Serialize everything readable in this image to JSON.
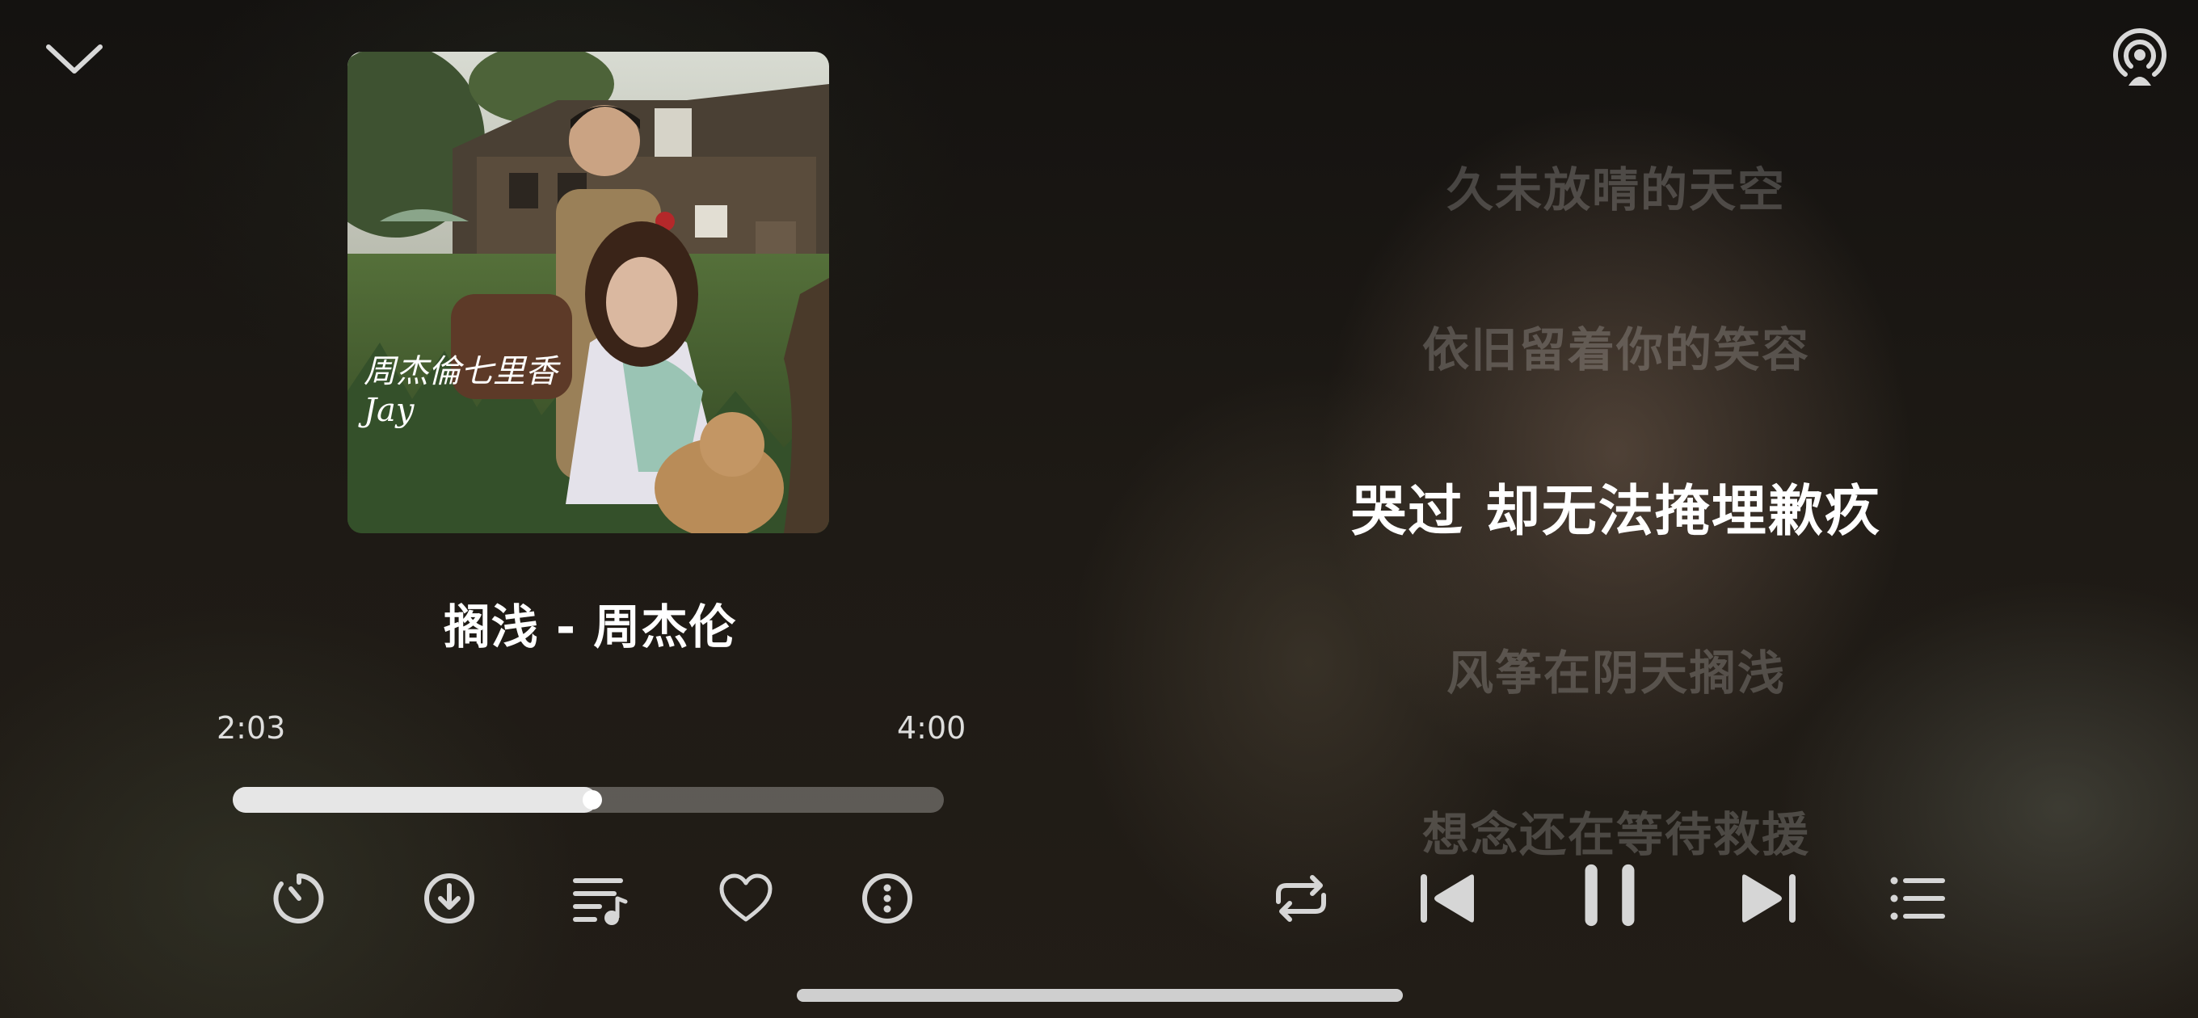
{
  "track": {
    "title_line": "搁浅 - 周杰伦",
    "album_art_text": "周杰倫七里香 Jay"
  },
  "playback": {
    "current_time": "2:03",
    "total_time": "4:00",
    "progress_fraction": 0.5125
  },
  "lyrics": {
    "lines": [
      "久未放晴的天空",
      "依旧留着你的笑容",
      "哭过 却无法掩埋歉疚",
      "风筝在阴天搁浅",
      "想念还在等待救援"
    ],
    "active_index": 2
  },
  "icons": {
    "collapse": "chevron-down-icon",
    "cast": "cast-icon",
    "timer": "sleep-timer-icon",
    "download": "download-icon",
    "playlist_add": "playlist-music-icon",
    "like": "heart-icon",
    "more": "more-icon",
    "repeat": "repeat-icon",
    "previous": "previous-track-icon",
    "pause": "pause-icon",
    "next": "next-track-icon",
    "queue": "queue-list-icon"
  },
  "colors": {
    "text_primary": "#ffffff",
    "text_dim": "rgba(255,255,255,0.2)",
    "progress_fill": "#e6e6e6",
    "progress_track": "rgba(255,255,255,0.28)"
  }
}
